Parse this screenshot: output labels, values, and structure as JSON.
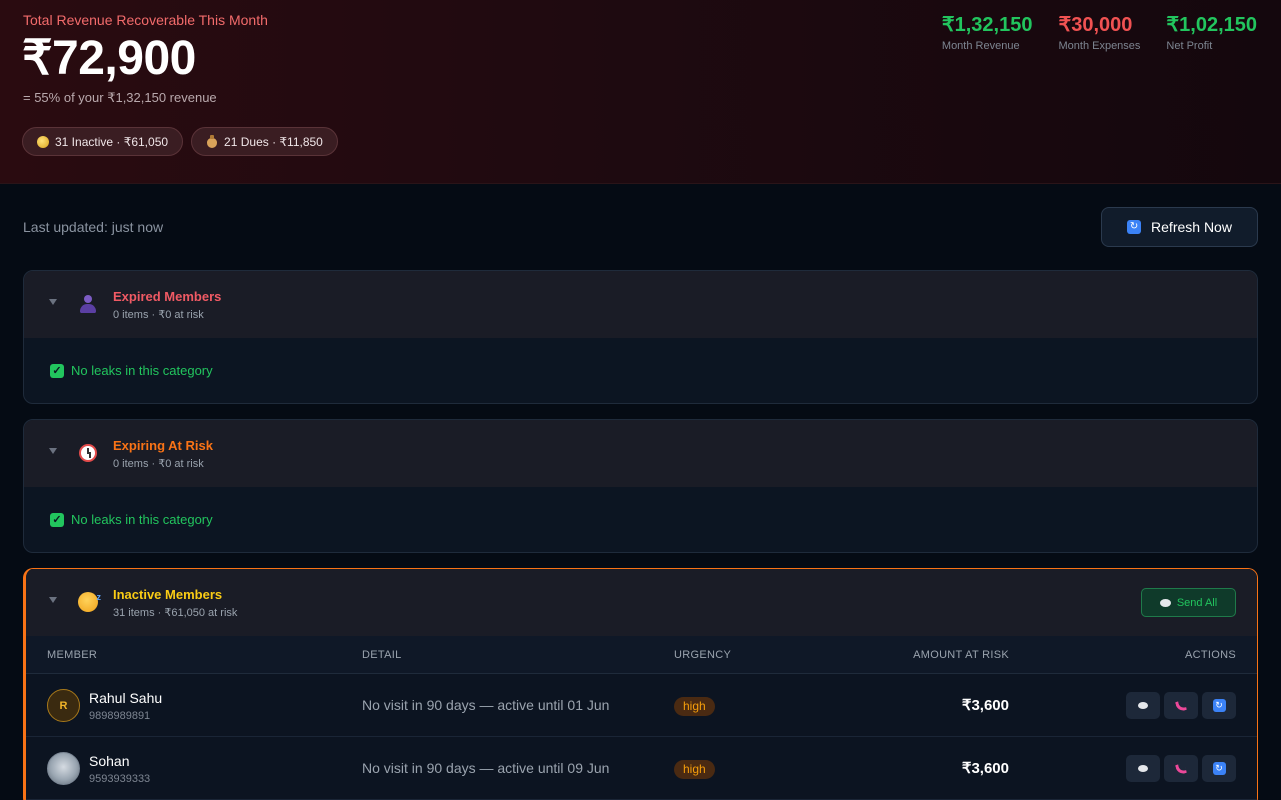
{
  "hero": {
    "label": "Total Revenue Recoverable This Month",
    "amount": "₹72,900",
    "sub": "= 55% of your ₹1,32,150 revenue",
    "chips": [
      {
        "icon": "coin-icon",
        "text": "31 Inactive · ₹61,050"
      },
      {
        "icon": "money-bag-icon",
        "text": "21 Dues · ₹11,850"
      }
    ]
  },
  "stats": [
    {
      "value": "₹1,32,150",
      "label": "Month Revenue",
      "color": "#22c55e"
    },
    {
      "value": "₹30,000",
      "label": "Month Expenses",
      "color": "#f05252"
    },
    {
      "value": "₹1,02,150",
      "label": "Net Profit",
      "color": "#22c55e"
    }
  ],
  "toolbar": {
    "updated": "Last updated: just now",
    "refresh_label": "Refresh Now"
  },
  "sections": [
    {
      "title": "Expired Members",
      "meta": "0 items · ₹0 at risk",
      "empty": "No leaks in this category",
      "title_color": "#f05a64",
      "icon": "person-icon"
    },
    {
      "title": "Expiring At Risk",
      "meta": "0 items · ₹0 at risk",
      "empty": "No leaks in this category",
      "title_color": "#f97316",
      "icon": "alarm-clock-icon"
    },
    {
      "title": "Inactive Members",
      "meta": "31 items · ₹61,050 at risk",
      "send_all": "Send All",
      "title_color": "#facc15",
      "icon": "sleeping-face-icon"
    }
  ],
  "table": {
    "headers": {
      "member": "MEMBER",
      "detail": "DETAIL",
      "urgency": "URGENCY",
      "amount": "AMOUNT AT RISK",
      "actions": "ACTIONS"
    },
    "rows": [
      {
        "initial": "R",
        "name": "Rahul Sahu",
        "phone": "9898989891",
        "detail": "No visit in 90 days — active until 01 Jun",
        "urgency": "high",
        "amount": "₹3,600"
      },
      {
        "initial": "",
        "name": "Sohan",
        "phone": "9593939333",
        "detail": "No visit in 90 days — active until 09 Jun",
        "urgency": "high",
        "amount": "₹3,600"
      }
    ]
  }
}
